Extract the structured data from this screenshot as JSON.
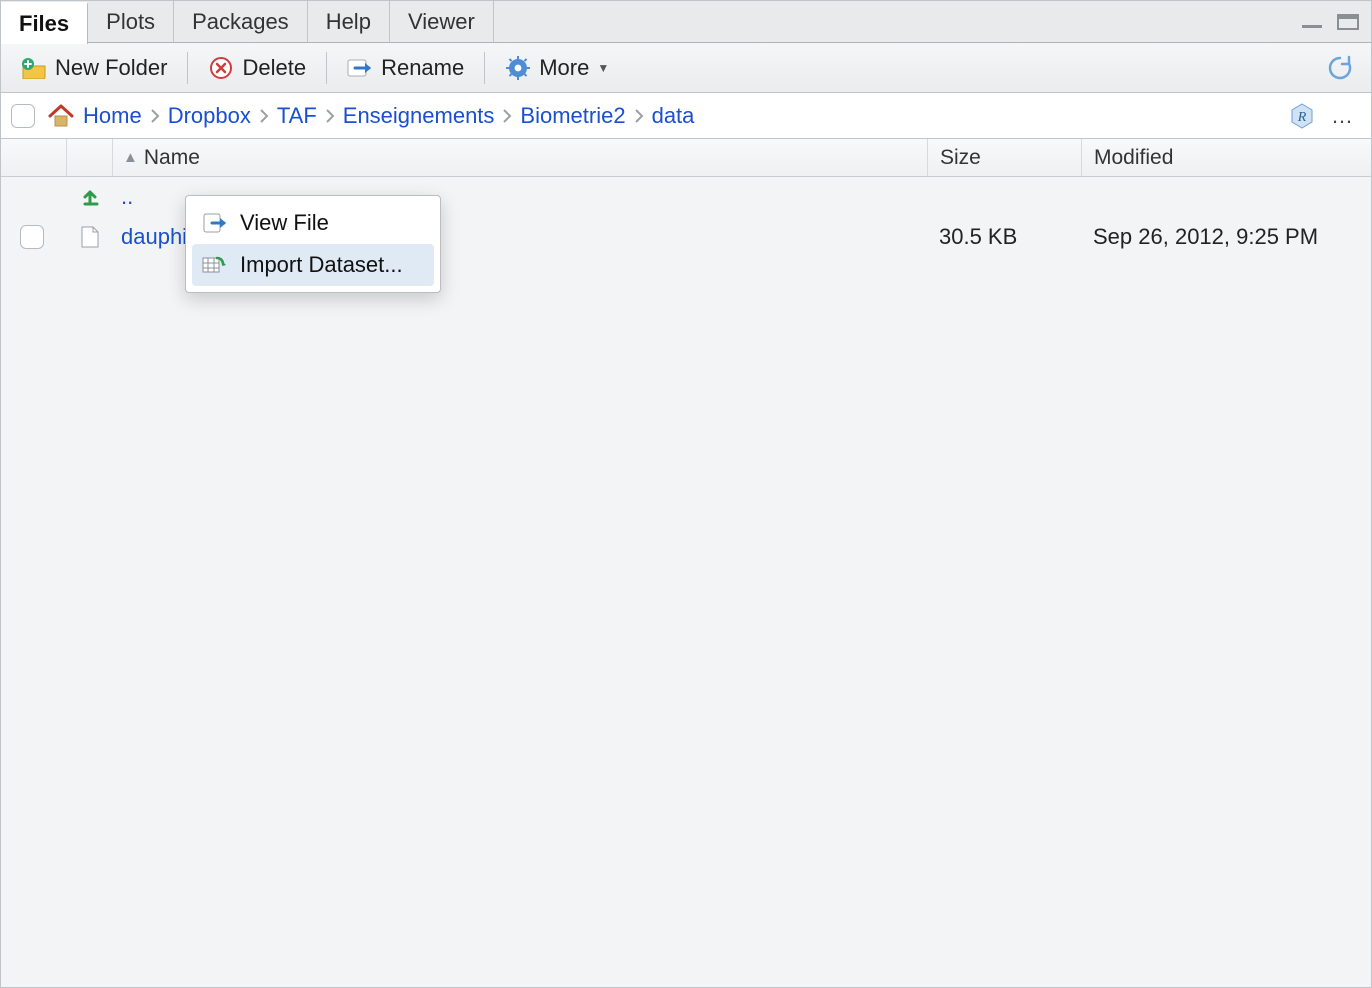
{
  "tabs": {
    "items": [
      "Files",
      "Plots",
      "Packages",
      "Help",
      "Viewer"
    ],
    "active_index": 0
  },
  "toolbar": {
    "new_folder": "New Folder",
    "delete": "Delete",
    "rename": "Rename",
    "more": "More"
  },
  "breadcrumb": {
    "items": [
      "Home",
      "Dropbox",
      "TAF",
      "Enseignements",
      "Biometrie2",
      "data"
    ]
  },
  "columns": {
    "name": "Name",
    "size": "Size",
    "modified": "Modified"
  },
  "rows": {
    "up": "..",
    "file": {
      "name": "dauphin.xls",
      "size": "30.5 KB",
      "modified": "Sep 26, 2012, 9:25 PM"
    }
  },
  "context_menu": {
    "view_file": "View File",
    "import_dataset": "Import Dataset...",
    "highlight_index": 1
  }
}
